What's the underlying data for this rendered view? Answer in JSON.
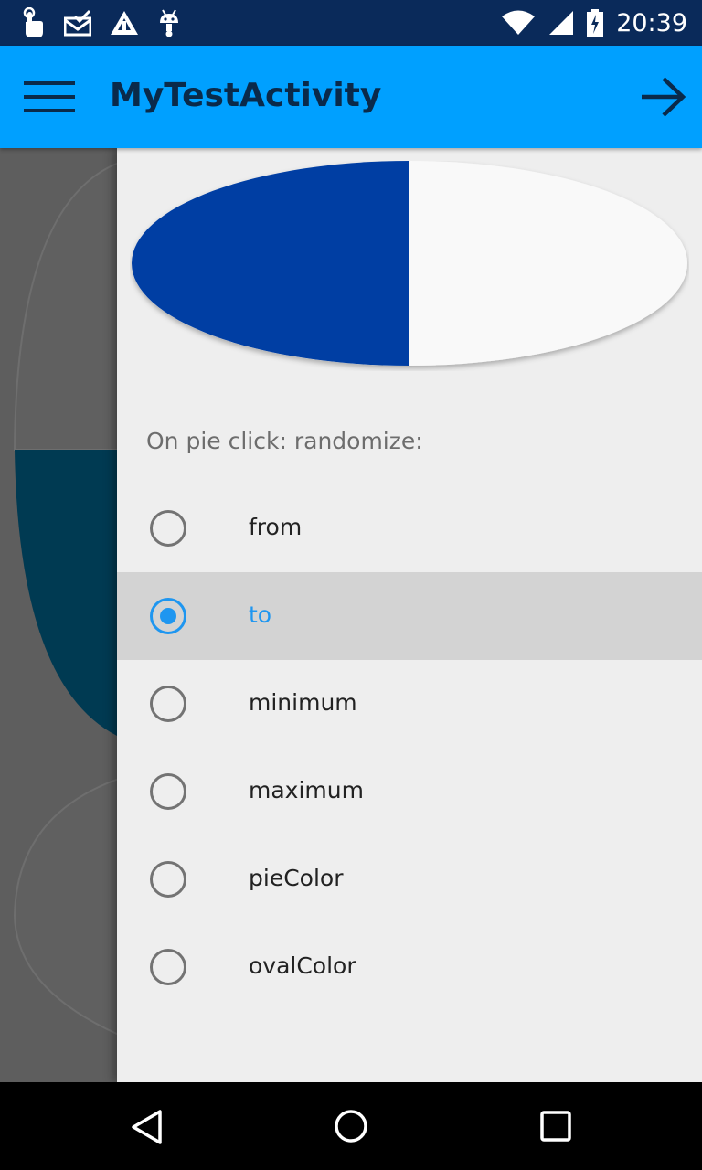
{
  "status_bar": {
    "time": "20:39",
    "left_icons": [
      "touch-icon",
      "mail-check-icon",
      "triangle-logo-icon",
      "android-icon"
    ],
    "right_icons": [
      "wifi-icon",
      "signal-icon",
      "battery-charging-icon"
    ]
  },
  "toolbar": {
    "title": "MyTestActivity",
    "menu_icon": "hamburger-menu-icon",
    "next_icon": "arrow-right-icon",
    "background": "#00a0ff"
  },
  "pie": {
    "fill_fraction": 0.5,
    "pie_color": "#003ea3",
    "oval_color": "#f9f9f9"
  },
  "drawer": {
    "section_label": "On pie click: randomize:",
    "selected_index": 1,
    "accent_color": "#1e96f0",
    "options": [
      {
        "label": "from",
        "selected": false
      },
      {
        "label": "to",
        "selected": true
      },
      {
        "label": "minimum",
        "selected": false
      },
      {
        "label": "maximum",
        "selected": false
      },
      {
        "label": "pieColor",
        "selected": false
      },
      {
        "label": "ovalColor",
        "selected": false
      }
    ]
  },
  "nav_bar": {
    "icons": [
      "back-triangle-icon",
      "home-circle-icon",
      "recents-square-icon"
    ]
  }
}
